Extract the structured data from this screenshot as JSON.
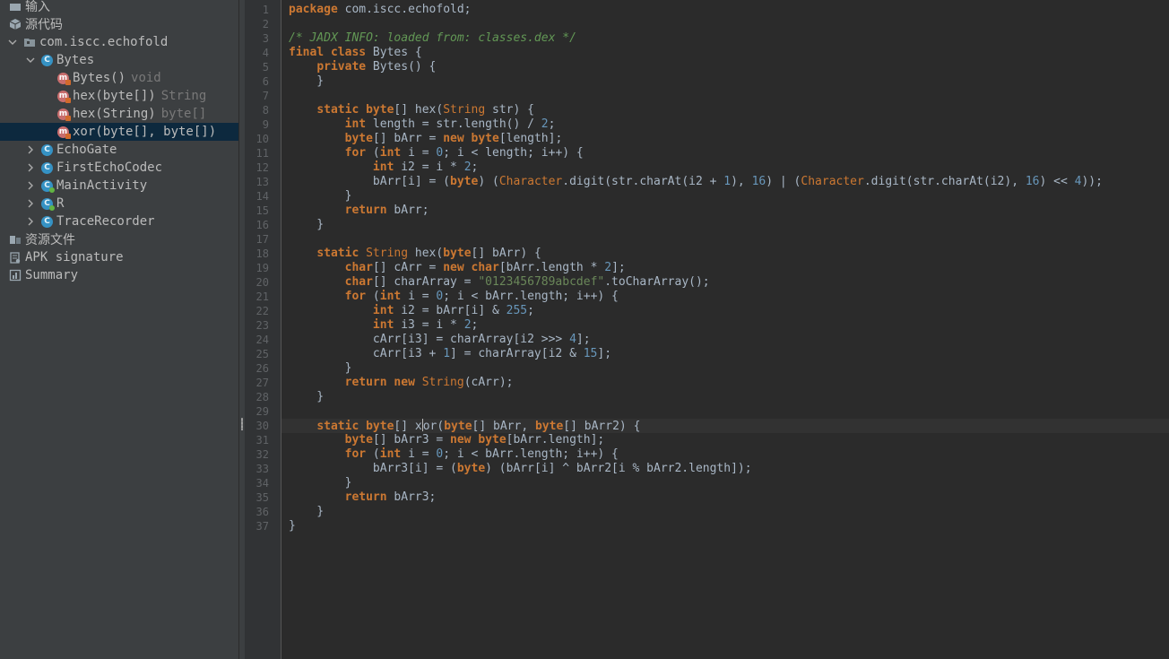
{
  "tree": {
    "rows": [
      {
        "label": "输入",
        "type": "folder"
      },
      {
        "label": "源代码",
        "type": "source"
      },
      {
        "label": "com.iscc.echofold",
        "type": "package"
      },
      {
        "label": "Bytes",
        "type": "class"
      },
      {
        "label": "Bytes()",
        "ret": "void",
        "type": "method"
      },
      {
        "label": "hex(byte[])",
        "ret": "String",
        "type": "method"
      },
      {
        "label": "hex(String)",
        "ret": "byte[]",
        "type": "method"
      },
      {
        "label": "xor(byte[], byte[])",
        "ret": "",
        "type": "method",
        "selected": true
      },
      {
        "label": "EchoGate",
        "type": "class"
      },
      {
        "label": "FirstEchoCodec",
        "type": "class"
      },
      {
        "label": "MainActivity",
        "type": "class"
      },
      {
        "label": "R",
        "type": "class"
      },
      {
        "label": "TraceRecorder",
        "type": "class"
      },
      {
        "label": "资源文件",
        "type": "resources"
      },
      {
        "label": "APK signature",
        "type": "signature"
      },
      {
        "label": "Summary",
        "type": "summary"
      }
    ]
  },
  "editor": {
    "current_line": 30,
    "lines": [
      "package com.iscc.echofold;",
      "",
      "/* JADX INFO: loaded from: classes.dex */",
      "final class Bytes {",
      "    private Bytes() {",
      "    }",
      "",
      "    static byte[] hex(String str) {",
      "        int length = str.length() / 2;",
      "        byte[] bArr = new byte[length];",
      "        for (int i = 0; i < length; i++) {",
      "            int i2 = i * 2;",
      "            bArr[i] = (byte) (Character.digit(str.charAt(i2 + 1), 16) | (Character.digit(str.charAt(i2), 16) << 4));",
      "        }",
      "        return bArr;",
      "    }",
      "",
      "    static String hex(byte[] bArr) {",
      "        char[] cArr = new char[bArr.length * 2];",
      "        char[] charArray = \"0123456789abcdef\".toCharArray();",
      "        for (int i = 0; i < bArr.length; i++) {",
      "            int i2 = bArr[i] & 255;",
      "            int i3 = i * 2;",
      "            cArr[i3] = charArray[i2 >>> 4];",
      "            cArr[i3 + 1] = charArray[i2 & 15];",
      "        }",
      "        return new String(cArr);",
      "    }",
      "",
      "    static byte[] xor(byte[] bArr, byte[] bArr2) {",
      "        byte[] bArr3 = new byte[bArr.length];",
      "        for (int i = 0; i < bArr.length; i++) {",
      "            bArr3[i] = (byte) (bArr[i] ^ bArr2[i % bArr2.length]);",
      "        }",
      "        return bArr3;",
      "    }",
      "}"
    ]
  },
  "colors": {
    "keyword": "#cc7832",
    "comment": "#629755",
    "number": "#6897bb",
    "string": "#6a8759",
    "text": "#a9b7c6"
  }
}
